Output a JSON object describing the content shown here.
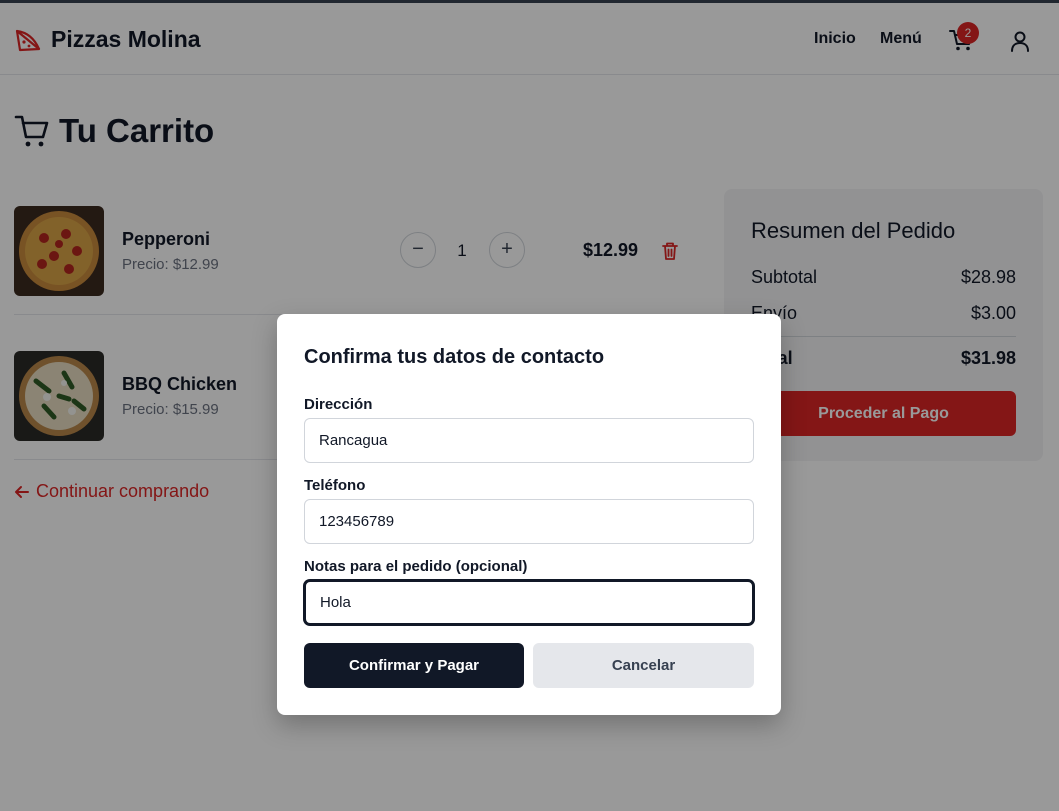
{
  "header": {
    "brand": "Pizzas Molina",
    "logo_icon": "pizza-slice-icon",
    "nav": {
      "inicio": "Inicio",
      "menu": "Menú"
    },
    "cart_icon": "shopping-cart-icon",
    "cart_count": "2",
    "user_icon": "user-icon"
  },
  "page": {
    "title": "Tu Carrito",
    "title_icon": "shopping-cart-icon"
  },
  "cart": {
    "items": [
      {
        "name": "Pepperoni",
        "price_label": "Precio: $12.99",
        "quantity": "1",
        "total": "$12.99",
        "minus": "−",
        "plus": "+"
      },
      {
        "name": "BBQ Chicken",
        "price_label": "Precio: $15.99"
      }
    ],
    "continue_label": "Continuar comprando"
  },
  "summary": {
    "title": "Resumen del Pedido",
    "subtotal_label": "Subtotal",
    "subtotal_value": "$28.98",
    "envio_label": "Envío",
    "envio_value": "$3.00",
    "total_label": "Total",
    "total_value": "$31.98",
    "pay_label": "Proceder al Pago"
  },
  "modal": {
    "title": "Confirma tus datos de contacto",
    "direccion_label": "Dirección",
    "direccion_value": "Rancagua",
    "telefono_label": "Teléfono",
    "telefono_value": "123456789",
    "notas_label": "Notas para el pedido (opcional)",
    "notas_value": "Hola",
    "confirm_label": "Confirmar y Pagar",
    "cancel_label": "Cancelar"
  },
  "colors": {
    "accent": "#dc2626",
    "dark": "#111827",
    "overlay": "rgba(0,0,0,0.4)"
  }
}
